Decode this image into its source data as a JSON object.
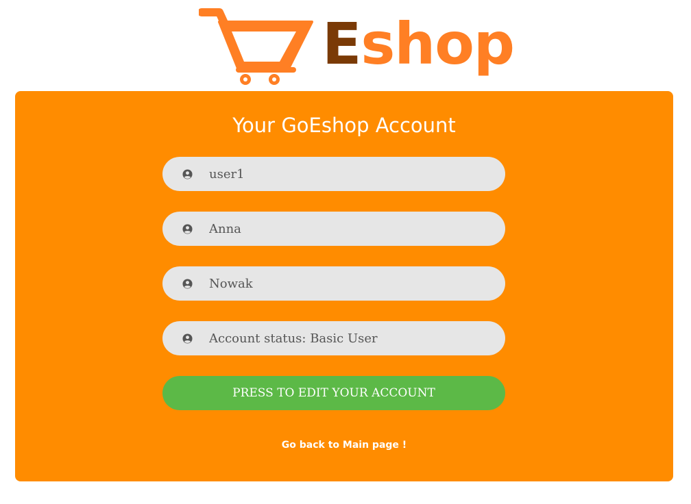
{
  "logo": {
    "text_first": "E",
    "text_rest": "shop",
    "icon": "shopping-cart-icon",
    "colors": {
      "cart": "#ff7f24",
      "first_letter": "#7a3a06",
      "rest": "#ff7f24"
    }
  },
  "account": {
    "title": "Your GoEshop Account",
    "fields": [
      {
        "value": "user1",
        "icon": "user-circle-icon"
      },
      {
        "value": "Anna",
        "icon": "user-circle-icon"
      },
      {
        "value": "Nowak",
        "icon": "user-circle-icon"
      },
      {
        "value": "Account status: Basic User",
        "icon": "user-circle-icon"
      }
    ],
    "edit_button_label": "PRESS TO EDIT YOUR ACCOUNT",
    "back_link_label": "Go back to Main page !"
  },
  "colors": {
    "card_background": "#ff8c00",
    "field_background": "#e6e6e6",
    "button_green": "#5cb947",
    "text_white": "#ffffff"
  }
}
